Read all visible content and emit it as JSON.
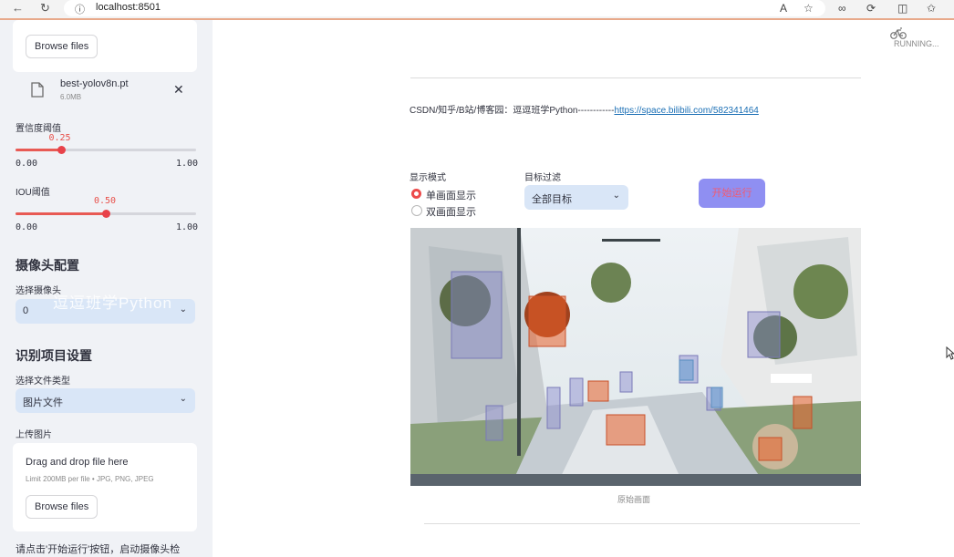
{
  "browser": {
    "url": "localhost:8501",
    "icons": [
      "back-arrow-icon",
      "reload-icon",
      "info-icon",
      "read-aloud-icon",
      "favorite-star-icon",
      "extensions-icon",
      "split-screen-icon",
      "favorites-icon"
    ]
  },
  "sidebar": {
    "model_uploader": {
      "browse_label": "Browse files",
      "file_name": "best-yolov8n.pt",
      "file_size": "6.0MB"
    },
    "confidence": {
      "label": "置信度阈值",
      "value_text": "0.25",
      "value": 0.25,
      "min": "0.00",
      "max": "1.00"
    },
    "iou": {
      "label": "IOU阈值",
      "value_text": "0.50",
      "value": 0.5,
      "min": "0.00",
      "max": "1.00"
    },
    "camera_header": "摄像头配置",
    "camera_select": {
      "label": "选择摄像头",
      "value": "0"
    },
    "watermark": "逗逗班学Python",
    "project_header": "识别项目设置",
    "file_type_select": {
      "label": "选择文件类型",
      "value": "图片文件"
    },
    "image_uploader": {
      "label": "上传图片",
      "dropzone_title": "Drag and drop file here",
      "dropzone_sub": "Limit 200MB per file • JPG, PNG, JPEG",
      "browse_label": "Browse files"
    },
    "bottom_hint": "请点击'开始运行'按钮，启动摄像头检"
  },
  "main": {
    "running_text": "RUNNING...",
    "credit_text": "CSDN/知乎/B站/博客园：逗逗班学Python------------",
    "credit_link": "https://space.bilibili.com/582341464",
    "display_mode": {
      "label": "显示模式",
      "options": [
        "单画面显示",
        "双画面显示"
      ],
      "selected": "单画面显示"
    },
    "target_filter": {
      "label": "目标过滤",
      "value": "全部目标"
    },
    "start_button": "开始运行",
    "image_caption": "原始画面"
  },
  "colors": {
    "accent": "#e8424a",
    "select_bg": "#d9e6f7",
    "button_bg": "#8f8ff2",
    "link": "#1a6fb5"
  }
}
